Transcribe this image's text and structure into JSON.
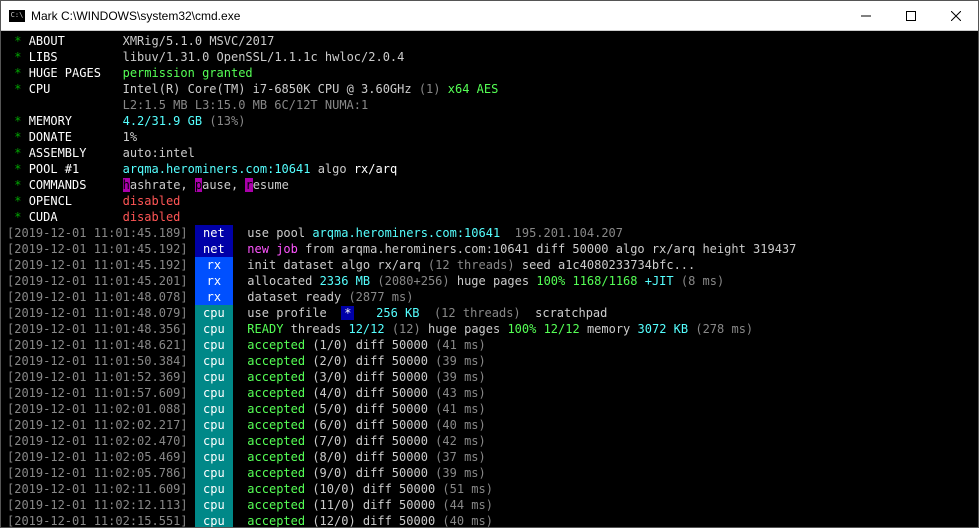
{
  "title": "Mark C:\\WINDOWS\\system32\\cmd.exe",
  "info": [
    {
      "label": "ABOUT",
      "val": "XMRig/5.1.0",
      "extra": "MSVC/2017"
    },
    {
      "label": "LIBS",
      "val": "libuv/1.31.0 OpenSSL/1.1.1c hwloc/2.0.4"
    },
    {
      "label": "HUGE PAGES",
      "val": "permission granted",
      "green": true
    },
    {
      "label": "CPU",
      "val": "Intel(R) Core(TM) i7-6850K CPU @ 3.60GHz",
      "count": "(1)",
      "feat": "x64 AES"
    },
    {
      "label": "",
      "sub": "L2:1.5 MB L3:15.0 MB 6C/12T NUMA:1"
    },
    {
      "label": "MEMORY",
      "val": "4.2/31.9 GB",
      "count": "(13%)",
      "cyan": true
    },
    {
      "label": "DONATE",
      "val": "1%"
    },
    {
      "label": "ASSEMBLY",
      "val": "auto:intel"
    },
    {
      "label": "POOL #1",
      "val": "arqma.herominers.com:10641",
      "algo": "algo",
      "algoval": "rx/arq"
    },
    {
      "label": "COMMANDS",
      "cmd": true
    },
    {
      "label": "OPENCL",
      "val": "disabled",
      "dis": true
    },
    {
      "label": "CUDA",
      "val": "disabled",
      "dis": true
    }
  ],
  "cmdkeys": {
    "h": "h",
    "h2": "ashrate,",
    "p": "p",
    "p2": "ause,",
    "r": "r",
    "r2": "esume"
  },
  "log": [
    {
      "t": "2019-12-01 11:01:45.189",
      "tag": "net",
      "msg": "use pool",
      "lc": "arqma.herominers.com:10641",
      "gr": "195.201.104.207"
    },
    {
      "t": "2019-12-01 11:01:45.192",
      "tag": "net",
      "m": "new job",
      "w": "from arqma.herominers.com:10641 diff 50000 algo rx/arq height 319437"
    },
    {
      "t": "2019-12-01 11:01:45.192",
      "tag": "rx",
      "w1": "init dataset algo rx/arq",
      "gr1": "(12 threads)",
      "w2": "seed a1c4080233734bfc..."
    },
    {
      "t": "2019-12-01 11:01:45.201",
      "tag": "rx",
      "w1": "allocated",
      "lc": "2336 MB",
      "gr1": "(2080+256)",
      "w2": "huge pages",
      "lg": "100% 1168/1168",
      "lc2": "+JIT",
      "gr2": "(8 ms)"
    },
    {
      "t": "2019-12-01 11:01:48.078",
      "tag": "rx",
      "w1": "dataset ready",
      "gr1": "(2877 ms)"
    },
    {
      "t": "2019-12-01 11:01:48.079",
      "tag": "cpu",
      "w1": "use profile ",
      "star": "*",
      "gr1": " (12 threads)",
      "w2": " scratchpad",
      "lc": " 256 KB"
    },
    {
      "t": "2019-12-01 11:01:48.356",
      "tag": "cpu",
      "lg1": "READY",
      "w1": "threads",
      "lc": "12/12",
      "gr1": "(12)",
      "w2": "huge pages",
      "lg": "100% 12/12",
      "w3": "memory",
      "lc2": "3072 KB",
      "gr2": "(278 ms)"
    },
    {
      "t": "2019-12-01 11:01:48.621",
      "tag": "cpu",
      "acc": "accepted",
      "stat": "(1/0)",
      "diff": "diff 50000",
      "ms": "(41 ms)"
    },
    {
      "t": "2019-12-01 11:01:50.384",
      "tag": "cpu",
      "acc": "accepted",
      "stat": "(2/0)",
      "diff": "diff 50000",
      "ms": "(39 ms)"
    },
    {
      "t": "2019-12-01 11:01:52.369",
      "tag": "cpu",
      "acc": "accepted",
      "stat": "(3/0)",
      "diff": "diff 50000",
      "ms": "(39 ms)"
    },
    {
      "t": "2019-12-01 11:01:57.609",
      "tag": "cpu",
      "acc": "accepted",
      "stat": "(4/0)",
      "diff": "diff 50000",
      "ms": "(43 ms)"
    },
    {
      "t": "2019-12-01 11:02:01.088",
      "tag": "cpu",
      "acc": "accepted",
      "stat": "(5/0)",
      "diff": "diff 50000",
      "ms": "(41 ms)"
    },
    {
      "t": "2019-12-01 11:02:02.217",
      "tag": "cpu",
      "acc": "accepted",
      "stat": "(6/0)",
      "diff": "diff 50000",
      "ms": "(40 ms)"
    },
    {
      "t": "2019-12-01 11:02:02.470",
      "tag": "cpu",
      "acc": "accepted",
      "stat": "(7/0)",
      "diff": "diff 50000",
      "ms": "(42 ms)"
    },
    {
      "t": "2019-12-01 11:02:05.469",
      "tag": "cpu",
      "acc": "accepted",
      "stat": "(8/0)",
      "diff": "diff 50000",
      "ms": "(37 ms)"
    },
    {
      "t": "2019-12-01 11:02:05.786",
      "tag": "cpu",
      "acc": "accepted",
      "stat": "(9/0)",
      "diff": "diff 50000",
      "ms": "(39 ms)"
    },
    {
      "t": "2019-12-01 11:02:11.609",
      "tag": "cpu",
      "acc": "accepted",
      "stat": "(10/0)",
      "diff": "diff 50000",
      "ms": "(51 ms)"
    },
    {
      "t": "2019-12-01 11:02:12.113",
      "tag": "cpu",
      "acc": "accepted",
      "stat": "(11/0)",
      "diff": "diff 50000",
      "ms": "(44 ms)"
    },
    {
      "t": "2019-12-01 11:02:15.551",
      "tag": "cpu",
      "acc": "accepted",
      "stat": "(12/0)",
      "diff": "diff 50000",
      "ms": "(40 ms)"
    }
  ]
}
